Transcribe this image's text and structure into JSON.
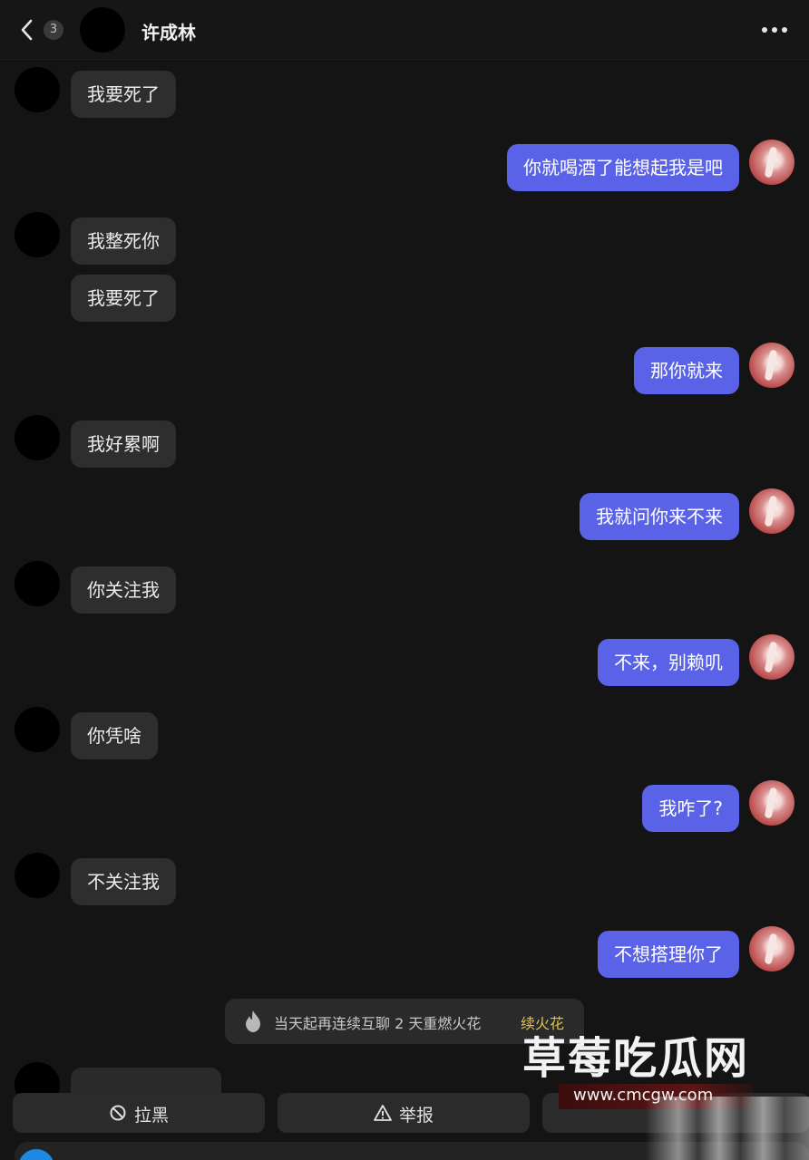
{
  "header": {
    "back_count": "3",
    "contact_name": "许成林"
  },
  "messages": [
    {
      "side": "in",
      "text": "我要死了"
    },
    {
      "side": "out",
      "text": "你就喝酒了能想起我是吧"
    },
    {
      "side": "in",
      "text": "我整死你"
    },
    {
      "side": "in",
      "text": "我要死了"
    },
    {
      "side": "out",
      "text": "那你就来"
    },
    {
      "side": "in",
      "text": "我好累啊"
    },
    {
      "side": "out",
      "text": "我就问你来不来"
    },
    {
      "side": "in",
      "text": "你关注我"
    },
    {
      "side": "out",
      "text": "不来，别赖叽"
    },
    {
      "side": "in",
      "text": "你凭啥"
    },
    {
      "side": "out",
      "text": "我咋了?"
    },
    {
      "side": "in",
      "text": "不关注我"
    },
    {
      "side": "out",
      "text": "不想搭理你了"
    }
  ],
  "spark_notice": {
    "text": "当天起再连续互聊 2 天重燃火花",
    "link": "续火花"
  },
  "watermark": {
    "title": "草莓吃瓜网",
    "url": "www.cmcgw.com"
  },
  "actions": {
    "block_label": "拉黑",
    "report_label": "举报"
  },
  "colors": {
    "outgoing_bubble": "#5a63e8",
    "incoming_bubble": "#2e2e2e",
    "background": "#141414",
    "link": "#e4c24a"
  }
}
